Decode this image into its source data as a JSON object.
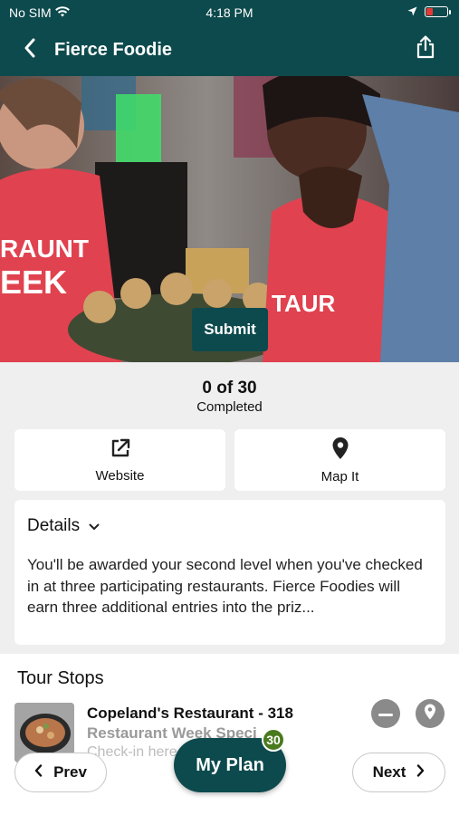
{
  "status_bar": {
    "carrier": "No SIM",
    "time": "4:18 PM"
  },
  "nav": {
    "title": "Fierce Foodie",
    "back_icon": "chevron-left-icon",
    "share_icon": "share-icon"
  },
  "hero": {
    "submit_label": "Submit"
  },
  "progress": {
    "count_text": "0 of 30",
    "label": "Completed"
  },
  "actions": {
    "website": {
      "label": "Website",
      "icon": "external-link-icon"
    },
    "map": {
      "label": "Map It",
      "icon": "map-pin-icon"
    }
  },
  "details": {
    "title": "Details",
    "body": "You'll be awarded your second level when you've checked in at three participating restaurants. Fierce Foodies will earn three additional entries into the priz..."
  },
  "tour": {
    "heading": "Tour Stops",
    "stops": [
      {
        "name": "Copeland's Restaurant - 318",
        "subtitle": "Restaurant Week Speci",
        "description": "Check-in here ... this"
      }
    ]
  },
  "bottom_nav": {
    "prev_label": "Prev",
    "next_label": "Next",
    "plan_label": "My Plan",
    "plan_badge": "30"
  },
  "colors": {
    "primary": "#0d4a4d",
    "badge": "#4a7a1e",
    "background": "#efefef"
  }
}
